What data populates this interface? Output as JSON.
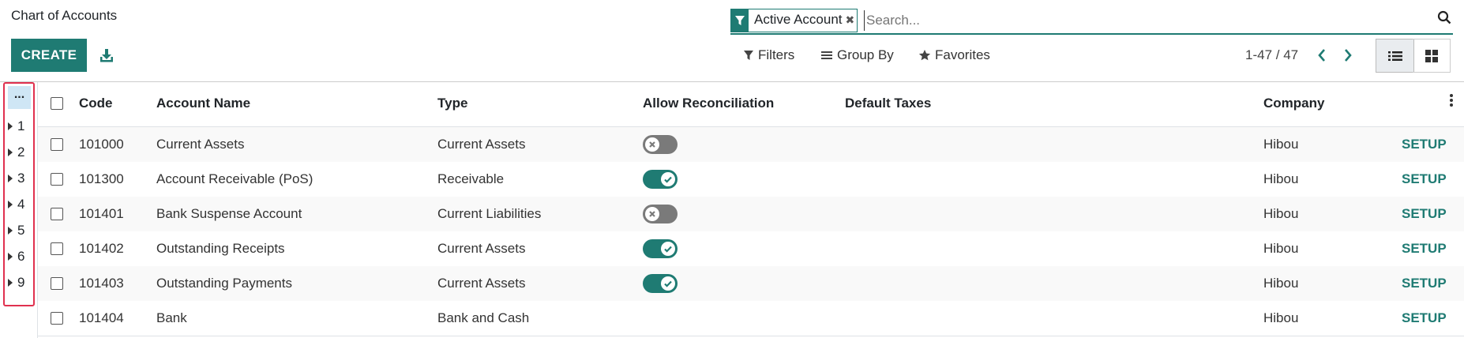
{
  "header": {
    "title": "Chart of Accounts",
    "create_label": "CREATE"
  },
  "search": {
    "facet_label": "Active Account",
    "placeholder": "Search..."
  },
  "menu": {
    "filters": "Filters",
    "group_by": "Group By",
    "favorites": "Favorites"
  },
  "pager": {
    "range": "1-47 / 47"
  },
  "groups": {
    "more_label": "...",
    "items": [
      "1",
      "2",
      "3",
      "4",
      "5",
      "6",
      "9"
    ]
  },
  "table": {
    "columns": {
      "code": "Code",
      "account_name": "Account Name",
      "type": "Type",
      "allow_reconciliation": "Allow Reconciliation",
      "default_taxes": "Default Taxes",
      "company": "Company"
    },
    "rows": [
      {
        "code": "101000",
        "name": "Current Assets",
        "type": "Current Assets",
        "reconcile": "off",
        "company": "Hibou",
        "action": "SETUP"
      },
      {
        "code": "101300",
        "name": "Account Receivable (PoS)",
        "type": "Receivable",
        "reconcile": "on",
        "company": "Hibou",
        "action": "SETUP"
      },
      {
        "code": "101401",
        "name": "Bank Suspense Account",
        "type": "Current Liabilities",
        "reconcile": "off",
        "company": "Hibou",
        "action": "SETUP"
      },
      {
        "code": "101402",
        "name": "Outstanding Receipts",
        "type": "Current Assets",
        "reconcile": "on",
        "company": "Hibou",
        "action": "SETUP"
      },
      {
        "code": "101403",
        "name": "Outstanding Payments",
        "type": "Current Assets",
        "reconcile": "on",
        "company": "Hibou",
        "action": "SETUP"
      },
      {
        "code": "101404",
        "name": "Bank",
        "type": "Bank and Cash",
        "reconcile": "none",
        "company": "Hibou",
        "action": "SETUP"
      }
    ]
  },
  "colors": {
    "accent": "#1f7b73",
    "highlight_border": "#e0314f",
    "toggle_off": "#7a7a7a"
  }
}
